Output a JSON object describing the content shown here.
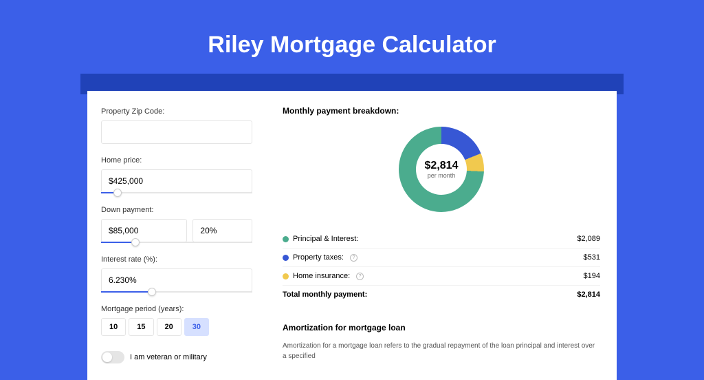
{
  "header": {
    "title": "Riley Mortgage Calculator"
  },
  "form": {
    "zip": {
      "label": "Property Zip Code:",
      "value": ""
    },
    "price": {
      "label": "Home price:",
      "value": "$425,000",
      "slider_pct": 8
    },
    "down": {
      "label": "Down payment:",
      "value": "$85,000",
      "pct": "20%",
      "slider_pct": 20
    },
    "rate": {
      "label": "Interest rate (%):",
      "value": "6.230%",
      "slider_pct": 31
    },
    "period": {
      "label": "Mortgage period (years):",
      "options": [
        "10",
        "15",
        "20",
        "30"
      ],
      "selected": "30"
    },
    "veteran": {
      "label": "I am veteran or military",
      "on": false
    }
  },
  "breakdown": {
    "title": "Monthly payment breakdown:",
    "center_amount": "$2,814",
    "center_sub": "per month",
    "rows": [
      {
        "label": "Principal & Interest:",
        "value": "$2,089",
        "color": "#4BAC8E",
        "help": false
      },
      {
        "label": "Property taxes:",
        "value": "$531",
        "color": "#3757D4",
        "help": true
      },
      {
        "label": "Home insurance:",
        "value": "$194",
        "color": "#F1C94E",
        "help": true
      }
    ],
    "total_label": "Total monthly payment:",
    "total_value": "$2,814"
  },
  "chart_data": {
    "type": "pie",
    "title": "Monthly payment breakdown",
    "series": [
      {
        "name": "Principal & Interest",
        "value": 2089,
        "color": "#4BAC8E"
      },
      {
        "name": "Property taxes",
        "value": 531,
        "color": "#3757D4"
      },
      {
        "name": "Home insurance",
        "value": 194,
        "color": "#F1C94E"
      }
    ],
    "total": 2814,
    "center_label": "$2,814 per month"
  },
  "amort": {
    "title": "Amortization for mortgage loan",
    "text": "Amortization for a mortgage loan refers to the gradual repayment of the loan principal and interest over a specified"
  }
}
